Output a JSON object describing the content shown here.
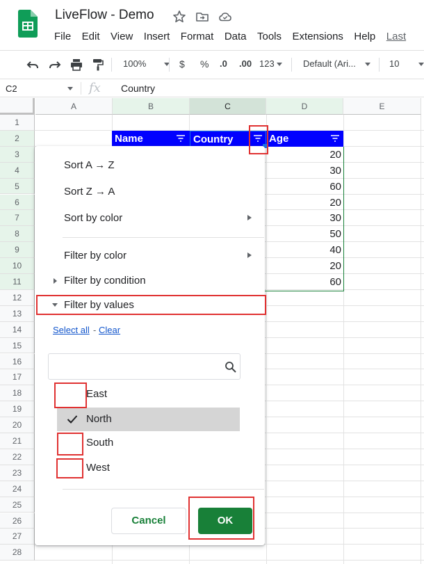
{
  "app": {
    "doc_title": "LiveFlow - Demo",
    "menu": [
      "File",
      "Edit",
      "View",
      "Insert",
      "Format",
      "Data",
      "Tools",
      "Extensions",
      "Help",
      "Last"
    ]
  },
  "toolbar": {
    "zoom": "100%",
    "currency": "$",
    "percent": "%",
    "dec_decrease": ".0",
    "dec_increase": ".00",
    "more_formats": "123",
    "font": "Default (Ari...",
    "font_size": "10"
  },
  "formula_bar": {
    "cell_ref": "C2",
    "fx": "fx",
    "content": "Country"
  },
  "grid": {
    "columns": [
      "A",
      "B",
      "C",
      "D",
      "E"
    ],
    "rows": [
      "1",
      "2",
      "3",
      "4",
      "5",
      "6",
      "7",
      "8",
      "9",
      "10",
      "11",
      "12",
      "13",
      "14",
      "15",
      "16",
      "17",
      "18",
      "19",
      "20",
      "21",
      "22",
      "23",
      "24",
      "25",
      "26",
      "27",
      "28"
    ],
    "headers": {
      "name": "Name",
      "country": "Country",
      "age": "Age"
    },
    "ages": [
      "20",
      "30",
      "60",
      "20",
      "30",
      "50",
      "40",
      "20",
      "60"
    ]
  },
  "filter_menu": {
    "sort_az": "Sort A → Z",
    "sort_za": "Sort Z → A",
    "sort_color": "Sort by color",
    "filter_color": "Filter by color",
    "filter_condition": "Filter by condition",
    "filter_values": "Filter by values",
    "select_all": "Select all",
    "dash": "-",
    "clear": "Clear",
    "search_placeholder": "",
    "options": [
      {
        "label": "East",
        "checked": false
      },
      {
        "label": "North",
        "checked": true
      },
      {
        "label": "South",
        "checked": false
      },
      {
        "label": "West",
        "checked": false
      }
    ],
    "cancel": "Cancel",
    "ok": "OK"
  },
  "colors": {
    "header_fill": "#0000ff",
    "accent_green": "#188038",
    "highlight_red": "#e03131"
  }
}
